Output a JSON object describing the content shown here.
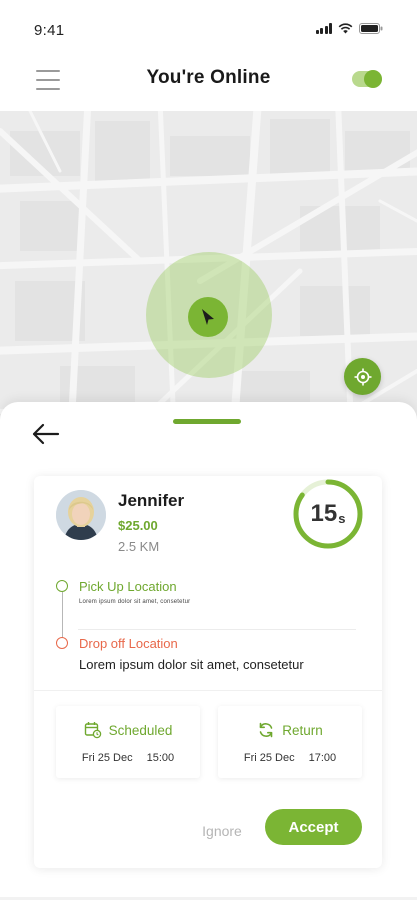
{
  "status_bar": {
    "time": "9:41",
    "icons": [
      "signal-icon",
      "wifi-icon",
      "battery-icon"
    ]
  },
  "header": {
    "title": "You're Online",
    "menu_icon": "hamburger-menu-icon",
    "toggle_on": true
  },
  "map": {
    "recenter_icon": "target-icon",
    "location_icon": "navigation-arrow-icon"
  },
  "ride_request": {
    "back_icon": "arrow-left-icon",
    "rider_name": "Jennifer",
    "fare": "$25.00",
    "distance": "2.5 KM",
    "countdown": {
      "value": "15",
      "unit": "s",
      "fraction_remaining": 0.85
    },
    "pickup": {
      "label": "Pick Up Location",
      "address": "Lorem ipsum dolor sit amet, consetetur"
    },
    "dropoff": {
      "label": "Drop off Location",
      "address": "Lorem ipsum dolor sit amet, consetetur"
    },
    "scheduled": {
      "title": "Scheduled",
      "icon": "calendar-clock-icon",
      "date": "Fri 25 Dec",
      "time": "15:00"
    },
    "return": {
      "title": "Return",
      "icon": "refresh-icon",
      "date": "Fri 25 Dec",
      "time": "17:00"
    },
    "ignore_label": "Ignore",
    "accept_label": "Accept"
  },
  "colors": {
    "accent": "#7bb534",
    "accent_dark": "#6fa82f",
    "dropoff": "#e8684a",
    "muted": "#b5b5b5"
  }
}
